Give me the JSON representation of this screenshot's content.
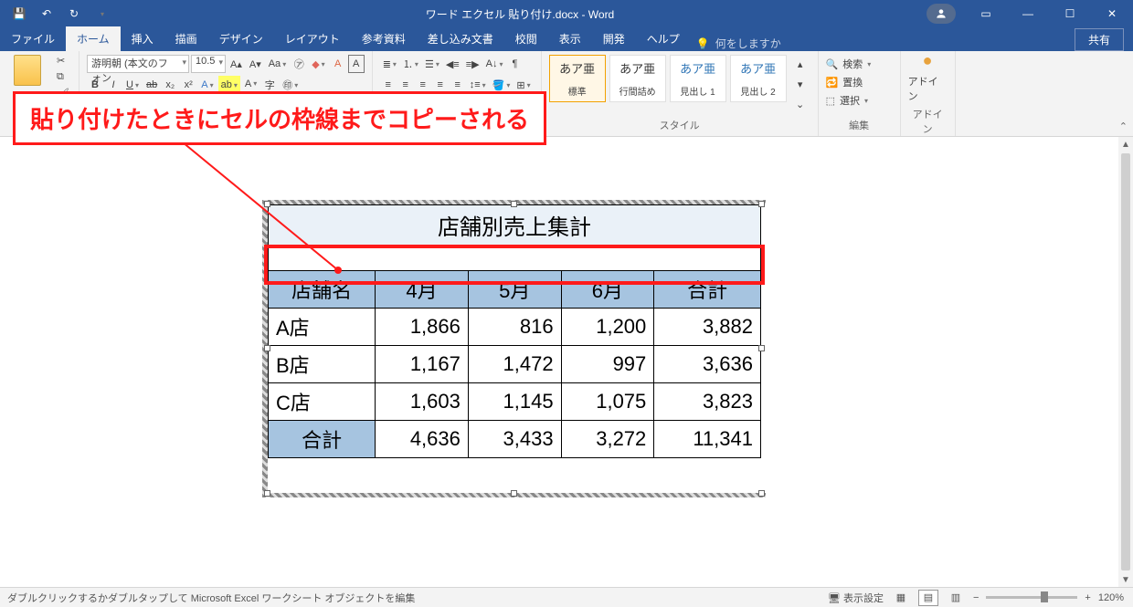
{
  "title": "ワード エクセル 貼り付け.docx  -  Word",
  "tabs": {
    "file": "ファイル",
    "home": "ホーム",
    "insert": "挿入",
    "draw": "描画",
    "design": "デザイン",
    "layout": "レイアウト",
    "ref": "参考資料",
    "mail": "差し込み文書",
    "review": "校閲",
    "view": "表示",
    "dev": "開発",
    "help": "ヘルプ"
  },
  "tellme": "何をしますか",
  "share": "共有",
  "font": {
    "name": "游明朝 (本文のフォン",
    "size": "10.5"
  },
  "styles": {
    "normal": "あア亜",
    "todo": "あア亜",
    "h1": "あア亜",
    "h2": "あア亜",
    "normal_lbl": "標準",
    "todo_lbl": "行間詰め",
    "h1_lbl": "見出し 1",
    "h2_lbl": "見出し 2",
    "group": "スタイル"
  },
  "edit": {
    "find": "検索",
    "replace": "置換",
    "select": "選択",
    "group": "編集"
  },
  "addin": {
    "label": "アドイン",
    "group": "アドイン"
  },
  "callout": "貼り付けたときにセルの枠線までコピーされる",
  "table": {
    "title": "店舗別売上集計",
    "headers": [
      "店舗名",
      "4月",
      "5月",
      "6月",
      "合計"
    ],
    "rows": [
      [
        "A店",
        "1,866",
        "816",
        "1,200",
        "3,882"
      ],
      [
        "B店",
        "1,167",
        "1,472",
        "997",
        "3,636"
      ],
      [
        "C店",
        "1,603",
        "1,145",
        "1,075",
        "3,823"
      ]
    ],
    "sum": [
      "合計",
      "4,636",
      "3,433",
      "3,272",
      "11,341"
    ]
  },
  "status": {
    "msg": "ダブルクリックするかダブルタップして Microsoft Excel ワークシート オブジェクトを編集",
    "display": "表示設定",
    "zoom": "120%"
  },
  "chart_data": {
    "type": "table",
    "title": "店舗別売上集計",
    "categories": [
      "4月",
      "5月",
      "6月",
      "合計"
    ],
    "series": [
      {
        "name": "A店",
        "values": [
          1866,
          816,
          1200,
          3882
        ]
      },
      {
        "name": "B店",
        "values": [
          1167,
          1472,
          997,
          3636
        ]
      },
      {
        "name": "C店",
        "values": [
          1603,
          1145,
          1075,
          3823
        ]
      },
      {
        "name": "合計",
        "values": [
          4636,
          3433,
          3272,
          11341
        ]
      }
    ]
  }
}
